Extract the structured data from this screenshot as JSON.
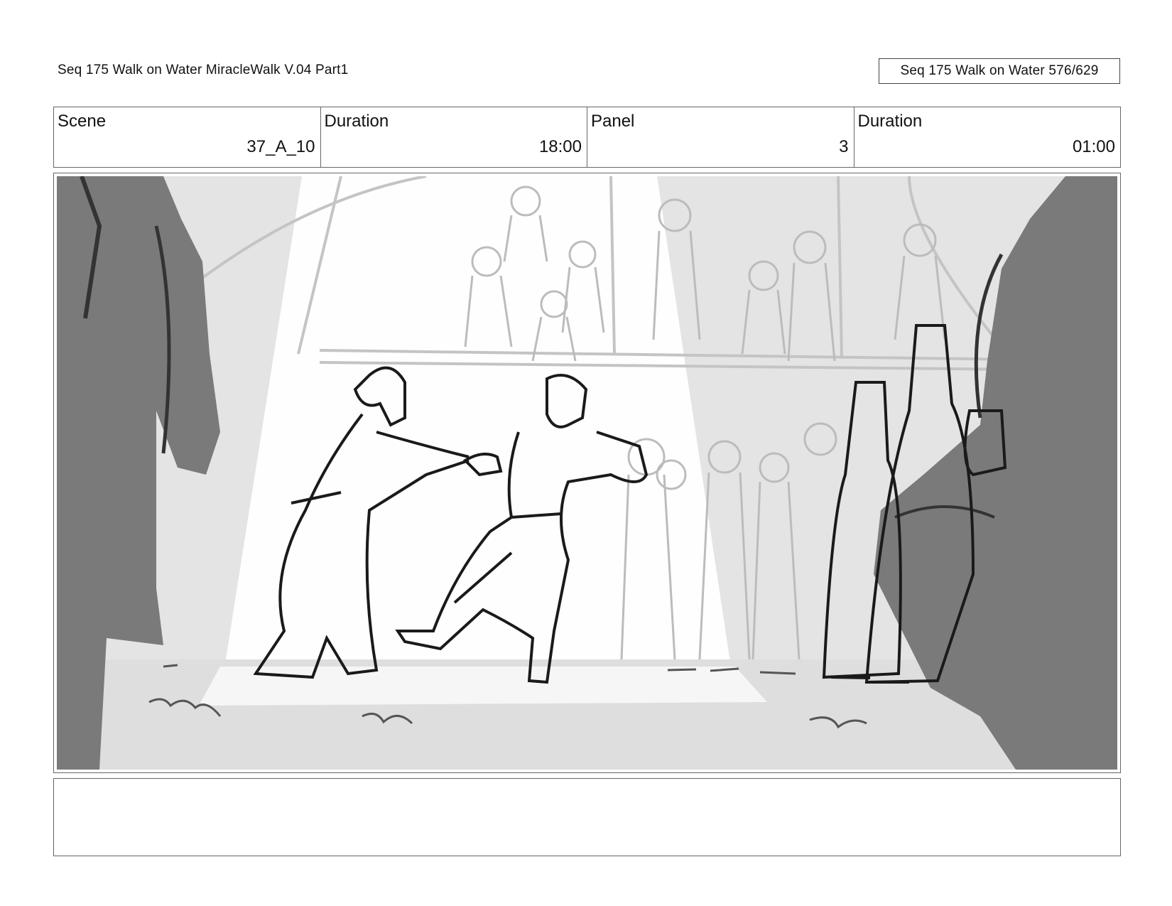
{
  "header": {
    "title": "Seq 175 Walk on Water  MiracleWalk V.04 Part1",
    "page_counter": "Seq 175 Walk on Water 576/629"
  },
  "info": {
    "scene_label": "Scene",
    "scene_value": "37_A_10",
    "duration_label": "Duration",
    "duration_value": "18:00",
    "panel_label": "Panel",
    "panel_value": "3",
    "panel_duration_label": "Duration",
    "panel_duration_value": "01:00"
  },
  "notes": {
    "text": ""
  },
  "colors": {
    "sketch_line": "#1a1a1a",
    "foreground_fill": "#7a7a7a",
    "spotlight": "#ffffff",
    "background": "#e6e6e6"
  }
}
